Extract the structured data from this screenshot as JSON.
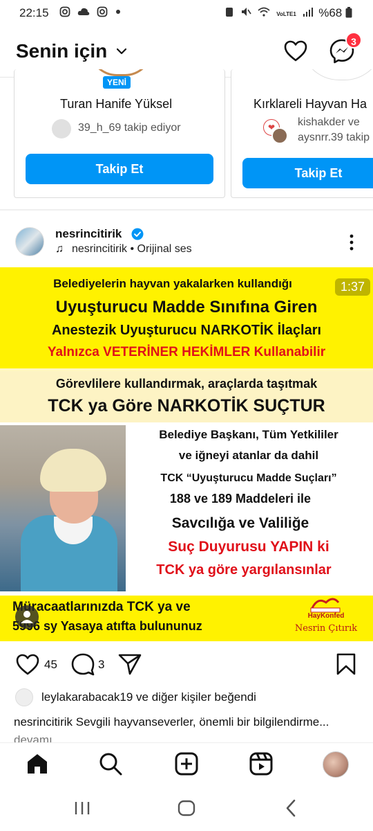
{
  "status_bar": {
    "time": "22:15",
    "left_icons": [
      "instagram-icon",
      "cloud-icon",
      "instagram-icon",
      "dot-icon"
    ],
    "battery": "%68",
    "network": "VoLTE1"
  },
  "header": {
    "title": "Senin için",
    "messages_badge": "3"
  },
  "suggestions": [
    {
      "badge": "YENİ",
      "name": "Turan Hanife Yüksel",
      "followed_by": "39_h_69 takip ediyor",
      "button": "Takip Et"
    },
    {
      "name": "Kırklareli Hayvan Ha",
      "followed_by_line1": "kishakder ve",
      "followed_by_line2": "aysnrr.39 takip",
      "button": "Takip Et"
    }
  ],
  "post": {
    "username": "nesrincitirik",
    "audio": "nesrincitirik • Orijinal ses",
    "video_time": "1:37",
    "image_text": {
      "line1": "Belediyelerin hayvan yakalarken kullandığı",
      "line2": "Uyuşturucu Madde Sınıfına Giren",
      "line3": "Anestezik Uyuşturucu NARKOTİK İlaçları",
      "line4": "Yalnızca VETERİNER HEKİMLER Kullanabilir",
      "line5": "Görevlilere kullandırmak, araçlarda taşıtmak",
      "line6": "TCK ya Göre NARKOTİK SUÇTUR",
      "line7": "Belediye Başkanı, Tüm Yetkililer",
      "line8": "ve iğneyi atanlar da dahil",
      "line9": "TCK “Uyuşturucu Madde Suçları”",
      "line10": "188 ve 189 Maddeleri ile",
      "line11": "Savcılığa ve Valiliğe",
      "line12": "Suç Duyurusu YAPIN ki",
      "line13": "TCK ya göre yargılansınlar",
      "line14": "Müracaatlarınızda TCK ya ve",
      "line15": "5996 sy Yasaya atıfta bulununuz",
      "logo_text": "HayKonfed",
      "signature": "Nesrin Çıtırık"
    },
    "likes": "45",
    "comments": "3",
    "liked_by_user": "leylakarabacak19",
    "liked_by_rest": "ve diğer kişiler beğendi",
    "caption_user": "nesrincitirik",
    "caption_text": "Sevgili hayvanseverler, önemli bir bilgilendirme...",
    "caption_more": "devamı"
  },
  "colors": {
    "accent": "#0095f6",
    "badge": "#ff3040",
    "image_yellow": "#fff200",
    "image_red": "#e0101a"
  }
}
